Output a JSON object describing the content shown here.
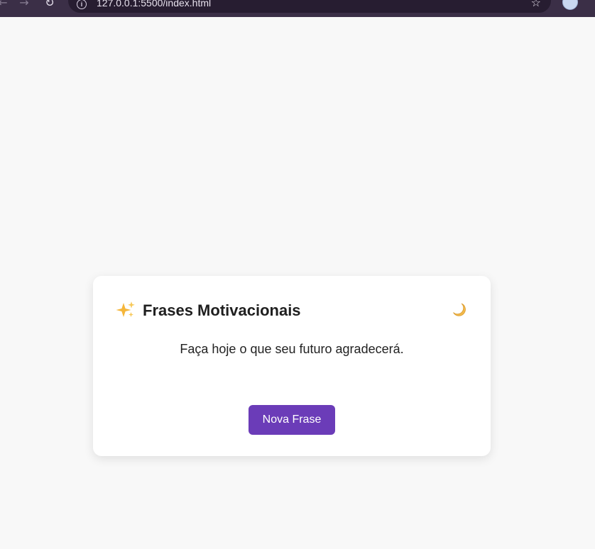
{
  "browser": {
    "url": "127.0.0.1:5500/index.html",
    "icons": {
      "back": "arrow-left-icon",
      "forward": "arrow-right-icon",
      "reload": "reload-icon",
      "info": "info-icon",
      "bookmark": "star-icon",
      "profile": "avatar"
    }
  },
  "card": {
    "title": "Frases Motivacionais",
    "quote": "Faça hoje o que seu futuro agradecerá.",
    "button_label": "Nova Frase",
    "icons": {
      "title": "sparkles-icon",
      "theme_toggle": "crescent-moon-icon"
    }
  },
  "colors": {
    "page_background": "#f8f8f8",
    "card_background": "#ffffff",
    "button_background": "#6b3cb8",
    "button_text": "#ffffff",
    "browser_chrome": "#3b2f47"
  }
}
